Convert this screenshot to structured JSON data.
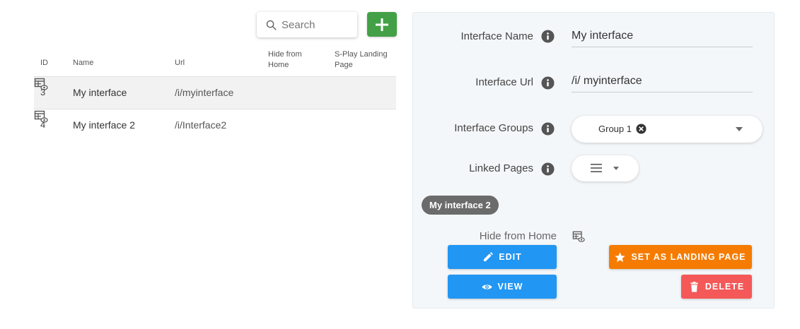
{
  "search": {
    "placeholder": "Search",
    "value": ""
  },
  "table": {
    "headers": {
      "id": "ID",
      "name": "Name",
      "url": "Url",
      "hide_from_home": "Hide from Home",
      "splay_landing_page": "S-Play Landing Page"
    },
    "rows": [
      {
        "id": "3",
        "name": "My interface",
        "url": "/i/myinterface",
        "hide_icon": "table-eye-icon",
        "selected": true
      },
      {
        "id": "4",
        "name": "My interface 2",
        "url": "/i/Interface2",
        "hide_icon": "table-eye-icon",
        "selected": false
      }
    ]
  },
  "detail": {
    "name_label": "Interface Name",
    "name_value": "My interface",
    "url_label": "Interface Url",
    "url_value": "/i/ myinterface",
    "groups_label": "Interface Groups",
    "groups_selected": [
      "Group 1"
    ],
    "linked_label": "Linked Pages",
    "linked_chip": "My interface 2",
    "hide_label": "Hide from Home",
    "buttons": {
      "edit": "EDIT",
      "view": "VIEW",
      "set_landing": "SET AS LANDING PAGE",
      "delete": "DELETE"
    }
  },
  "colors": {
    "add_button": "#43a047",
    "primary": "#2196f3",
    "landing": "#f57c00",
    "delete": "#f45858",
    "panel_bg": "#f4f7f9",
    "chip_bg": "#6b6b6b"
  }
}
